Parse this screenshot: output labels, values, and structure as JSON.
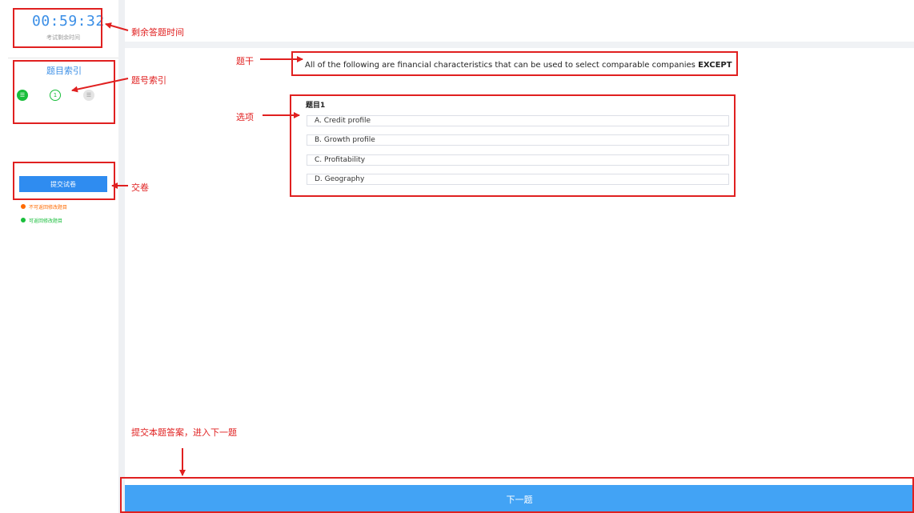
{
  "timer": {
    "value": "00:59:32",
    "subtitle": "考试剩余时间"
  },
  "question_index": {
    "title": "题目索引",
    "items": [
      {
        "label": "☰",
        "state": "current"
      },
      {
        "label": "1",
        "state": "answered"
      },
      {
        "label": "☰",
        "state": "disabled"
      }
    ]
  },
  "submit": {
    "label": "提交试卷"
  },
  "legend": [
    {
      "text": "不可返回修改题目",
      "color": "#ff6a00"
    },
    {
      "text": "可返回修改题目",
      "color": "#19be3b"
    }
  ],
  "question": {
    "stem": "All of the following are financial characteristics that can be used to select comparable companies",
    "stem_emphasis": "EXCEPT",
    "number": "题目1",
    "options": [
      "A. Credit profile",
      "B. Growth profile",
      "C. Profitability",
      "D. Geography"
    ]
  },
  "next_button": {
    "label": "下一题"
  },
  "annotations": {
    "timer": "剩余答题时间",
    "index": "题号索引",
    "submit": "交卷",
    "stem": "题干",
    "options": "选项",
    "next": "提交本题答案，进入下一题"
  },
  "colors": {
    "accent": "#3a8ee6",
    "button": "#2f8cf0",
    "next": "#42a3f5",
    "annotation": "#e02020"
  }
}
